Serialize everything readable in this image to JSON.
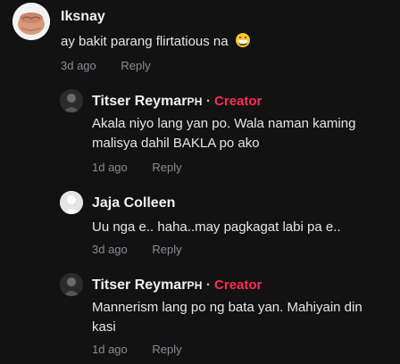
{
  "comments": [
    {
      "username": "Iksnay",
      "text": "ay bakit parang flirtatious na",
      "emoji": "grinning-sweat-face",
      "time": "3d ago",
      "reply_label": "Reply"
    }
  ],
  "replies": [
    {
      "username": "Titser Reymar",
      "username_suffix": "PH",
      "separator": "·",
      "badge": "Creator",
      "text": "Akala niyo lang yan po. Wala naman kaming malisya dahil BAKLA po ako",
      "time": "1d ago",
      "reply_label": "Reply"
    },
    {
      "username": "Jaja Colleen",
      "text": "Uu nga e.. haha..may pagkagat labi pa e..",
      "time": "3d ago",
      "reply_label": "Reply"
    },
    {
      "username": "Titser Reymar",
      "username_suffix": "PH",
      "separator": "·",
      "badge": "Creator",
      "text": "Mannerism lang po ng bata yan. Mahiyain din kasi",
      "time": "1d ago",
      "reply_label": "Reply"
    }
  ],
  "colors": {
    "background": "#121212",
    "creator_badge": "#fe2c55",
    "meta_text": "#8a8b91"
  }
}
